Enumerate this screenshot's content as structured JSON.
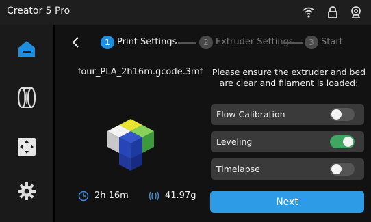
{
  "app": {
    "title": "Creator 5 Pro"
  },
  "topbar_icons": [
    "wifi-icon",
    "lock-icon",
    "webcam-icon"
  ],
  "sidebar": {
    "items": [
      {
        "name": "home",
        "icon": "home-icon",
        "active": true
      },
      {
        "name": "filament",
        "icon": "filament-spool-icon",
        "active": false
      },
      {
        "name": "move",
        "icon": "move-control-icon",
        "active": false
      },
      {
        "name": "settings",
        "icon": "gear-icon",
        "active": false
      }
    ]
  },
  "steps": [
    {
      "number": "1",
      "label": "Print Settings",
      "active": true
    },
    {
      "number": "2",
      "label": "Extruder Settings",
      "active": false
    },
    {
      "number": "3",
      "label": "Start",
      "active": false
    }
  ],
  "file": {
    "name": "four_PLA_2h16m.gcode.3mf",
    "time": "2h 16m",
    "weight": "41.97g"
  },
  "notice": "Please ensure the extruder and bed are clear and filament is loaded:",
  "options": [
    {
      "label": "Flow Calibration",
      "enabled": false
    },
    {
      "label": "Leveling",
      "enabled": true
    },
    {
      "label": "Timelapse",
      "enabled": false
    }
  ],
  "next_label": "Next",
  "colors": {
    "accent": "#2e9be6",
    "toggle_on": "#3fa760",
    "sidebar_active": "#1e8fe0"
  }
}
